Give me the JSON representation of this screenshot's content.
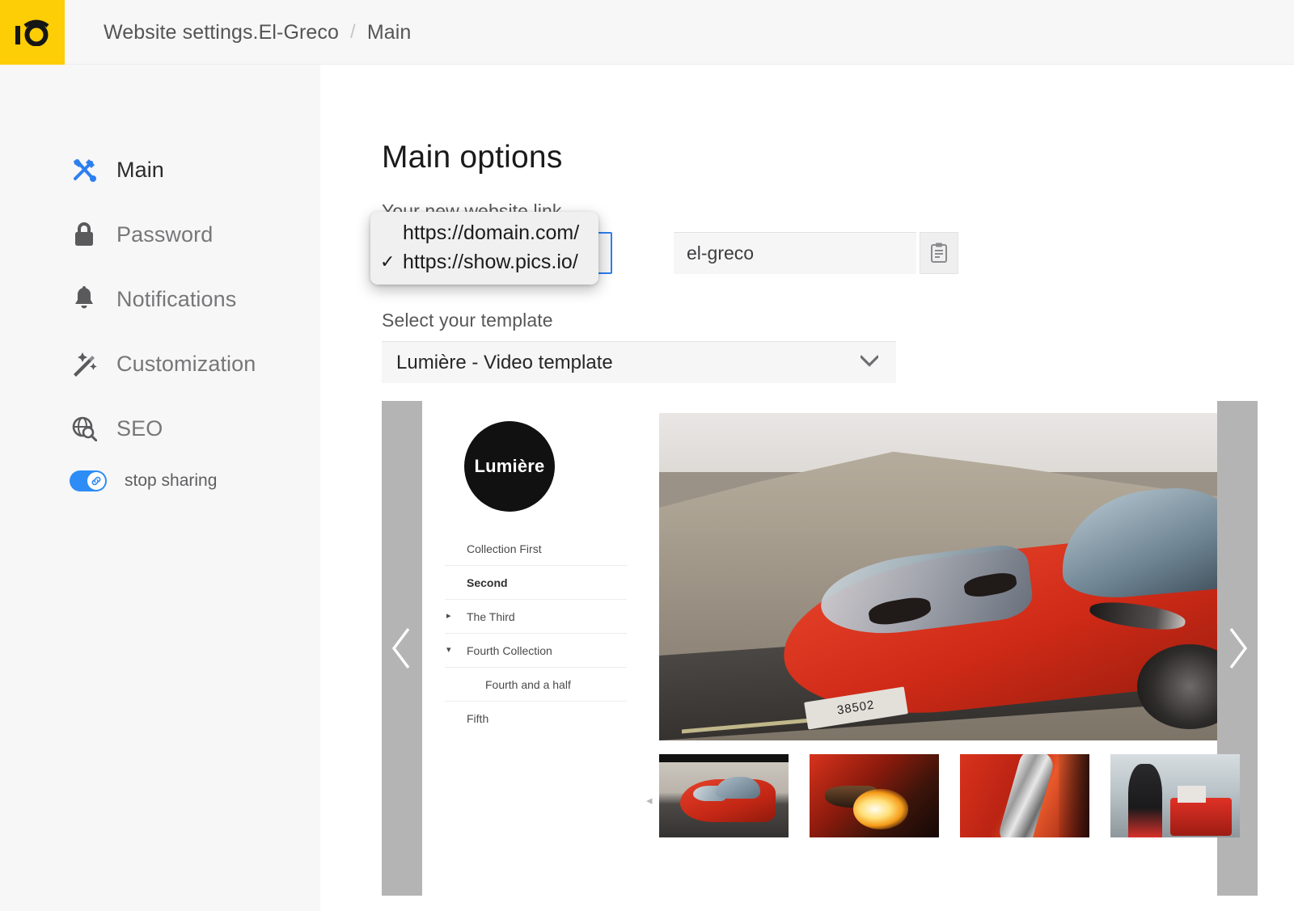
{
  "header": {
    "logo_glyph": "iō",
    "breadcrumb": {
      "parent": "Website settings.El-Greco",
      "separator": "/",
      "current": "Main"
    }
  },
  "sidebar": {
    "items": [
      {
        "label": "Main",
        "icon": "tools-icon",
        "active": true
      },
      {
        "label": "Password",
        "icon": "lock-icon",
        "active": false
      },
      {
        "label": "Notifications",
        "icon": "bell-icon",
        "active": false
      },
      {
        "label": "Customization",
        "icon": "magic-wand-icon",
        "active": false
      },
      {
        "label": "SEO",
        "icon": "globe-search-icon",
        "active": false
      }
    ],
    "share_toggle": {
      "label": "stop sharing",
      "state": "on",
      "icon": "link-icon",
      "color": "#2d8cf6"
    }
  },
  "main": {
    "title": "Main options",
    "link_field": {
      "label": "Your new website link",
      "selected_domain": "https://show.pics.io/",
      "slug_value": "el-greco",
      "copy_icon": "clipboard-icon"
    },
    "domain_dropdown": {
      "open": true,
      "check_glyph": "✓",
      "options": [
        {
          "label": "https://domain.com/",
          "selected": false
        },
        {
          "label": "https://show.pics.io/",
          "selected": true
        }
      ]
    },
    "template_field": {
      "label": "Select your template",
      "value": "Lumière - Video template",
      "caret_icon": "chevron-down-icon"
    }
  },
  "preview": {
    "prev_arrow": "chevron-left-icon",
    "next_arrow": "chevron-right-icon",
    "brand": "Lumière",
    "collections": [
      {
        "label": "Collection First",
        "bullet": "",
        "bold": false,
        "child": false
      },
      {
        "label": "Second",
        "bullet": "",
        "bold": true,
        "child": false
      },
      {
        "label": "The Third",
        "bullet": "▸",
        "bold": false,
        "child": false
      },
      {
        "label": "Fourth Collection",
        "bullet": "▾",
        "bold": false,
        "child": false
      },
      {
        "label": "Fourth and a half",
        "bullet": "",
        "bold": false,
        "child": true
      },
      {
        "label": "Fifth",
        "bullet": "",
        "bold": false,
        "child": false
      }
    ],
    "hero": {
      "alt": "red-sports-car-in-desert",
      "plate": "38502"
    },
    "thumbnails": [
      {
        "alt": "red-sports-car-front",
        "selected": true
      },
      {
        "alt": "exhaust-flame",
        "selected": false
      },
      {
        "alt": "chrome-car-detail",
        "selected": false
      },
      {
        "alt": "pit-crew-garage",
        "selected": false
      }
    ],
    "thumb_prev_arrow": "◂",
    "thumb_next_arrow": "▸"
  },
  "colors": {
    "brand_yellow": "#fdcd06",
    "accent_blue": "#2d8cf6",
    "sidebar_bg": "#f7f7f7",
    "carousel_gray": "#b4b4b4"
  }
}
